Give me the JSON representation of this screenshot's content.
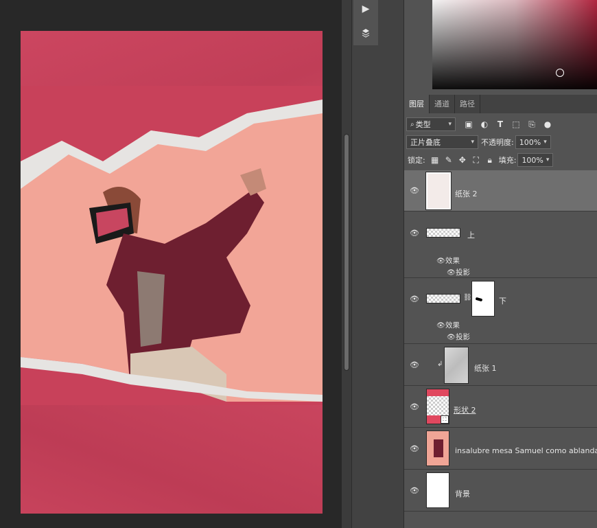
{
  "tabs": [
    "图层",
    "通道",
    "路径"
  ],
  "filter": {
    "label": "类型"
  },
  "blend": {
    "mode": "正片叠底",
    "opacity_label": "不透明度:",
    "opacity_value": "100%"
  },
  "lock": {
    "label": "锁定:",
    "fill_label": "填充:",
    "fill_value": "100%"
  },
  "layers": [
    {
      "name": "纸张 2"
    },
    {
      "name": "上",
      "effects_label": "效果",
      "effect": "投影"
    },
    {
      "name": "下",
      "effects_label": "效果",
      "effect": "投影"
    },
    {
      "name": "纸张 1"
    },
    {
      "name": "形状 2"
    },
    {
      "name": "insalubre mesa Samuel como ablandar una"
    },
    {
      "name": "背景"
    }
  ],
  "colors": {
    "canvas_bg": "#282828",
    "panel_bg": "#535353",
    "selected_row": "#6f6f6f",
    "paper_red": "#c8415a",
    "paper_pink": "#f2a597"
  },
  "icons": [
    "play-icon",
    "3d-layers-icon",
    "eye-icon",
    "search-icon",
    "image-filter-icon",
    "adjustment-filter-icon",
    "type-filter-icon",
    "shape-filter-icon",
    "smart-object-filter-icon",
    "toggle-filter-icon",
    "lock-pixels-icon",
    "brush-icon",
    "move-icon",
    "artboard-icon",
    "lock-icon",
    "link-icon",
    "clip-arrow-icon"
  ]
}
